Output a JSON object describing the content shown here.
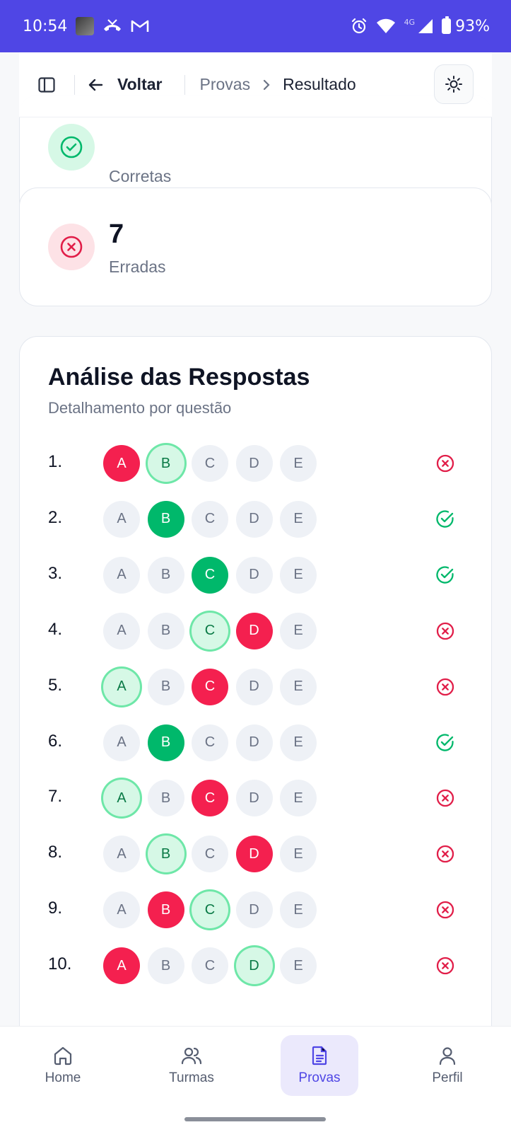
{
  "status_bar": {
    "time": "10:54",
    "network": "4G",
    "battery": "93%"
  },
  "header": {
    "back_label": "Voltar",
    "crumb_parent": "Provas",
    "crumb_current": "Resultado"
  },
  "stats": {
    "correct": {
      "value": "",
      "label": "Corretas"
    },
    "wrong": {
      "value": "7",
      "label": "Erradas"
    }
  },
  "analysis": {
    "title": "Análise das Respostas",
    "subtitle": "Detalhamento por questão",
    "options": [
      "A",
      "B",
      "C",
      "D",
      "E"
    ],
    "questions": [
      {
        "num": "1.",
        "selected": "A",
        "correct": "B",
        "result": "wrong"
      },
      {
        "num": "2.",
        "selected": "B",
        "correct": "B",
        "result": "right"
      },
      {
        "num": "3.",
        "selected": "C",
        "correct": "C",
        "result": "right"
      },
      {
        "num": "4.",
        "selected": "D",
        "correct": "C",
        "result": "wrong"
      },
      {
        "num": "5.",
        "selected": "C",
        "correct": "A",
        "result": "wrong"
      },
      {
        "num": "6.",
        "selected": "B",
        "correct": "B",
        "result": "right"
      },
      {
        "num": "7.",
        "selected": "C",
        "correct": "A",
        "result": "wrong"
      },
      {
        "num": "8.",
        "selected": "D",
        "correct": "B",
        "result": "wrong"
      },
      {
        "num": "9.",
        "selected": "B",
        "correct": "C",
        "result": "wrong"
      },
      {
        "num": "10.",
        "selected": "A",
        "correct": "D",
        "result": "wrong"
      }
    ]
  },
  "nav": {
    "items": [
      {
        "label": "Home",
        "icon": "home-icon",
        "active": false
      },
      {
        "label": "Turmas",
        "icon": "users-icon",
        "active": false
      },
      {
        "label": "Provas",
        "icon": "document-icon",
        "active": true
      },
      {
        "label": "Perfil",
        "icon": "user-icon",
        "active": false
      }
    ]
  },
  "colors": {
    "accent": "#4f46e5",
    "correct": "#00b86b",
    "wrong": "#f4204f"
  }
}
